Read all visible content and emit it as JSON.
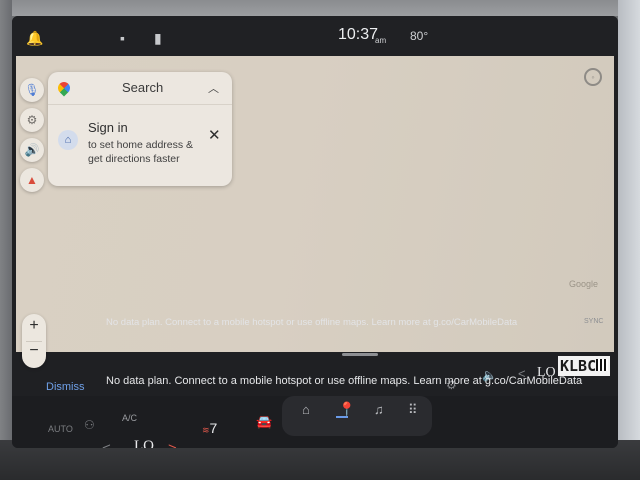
{
  "statusbar": {
    "time": "10:37",
    "ampm": "am",
    "temp": "80°",
    "icons": [
      "bell-icon",
      "message-icon",
      "calendar-icon"
    ]
  },
  "map": {
    "attribution": "Google",
    "zoom_in": "+",
    "zoom_out": "−"
  },
  "search_card": {
    "search_label": "Search",
    "signin_title": "Sign in",
    "signin_subtitle": "to set home address & get directions faster"
  },
  "notice": {
    "sync_label": "SYNC",
    "dismiss_label": "Dismiss",
    "message": "No data plan. Connect to a mobile hotspot or use offline maps. Learn more at g.co/CarMobileData"
  },
  "climate": {
    "auto_label": "AUTO",
    "ac_label": "A/C",
    "left_temp": "LO",
    "right_temp": "LO",
    "seat_level": "7"
  },
  "nav": {
    "items": [
      "home-icon",
      "navigation-icon",
      "music-icon",
      "apps-icon"
    ],
    "active": "navigation-icon"
  },
  "watermark": {
    "text": "KLBC"
  },
  "colors": {
    "map_bg": "#d8cfc2",
    "accent_blue": "#6fa0e8",
    "heat_red": "#e0584b"
  }
}
